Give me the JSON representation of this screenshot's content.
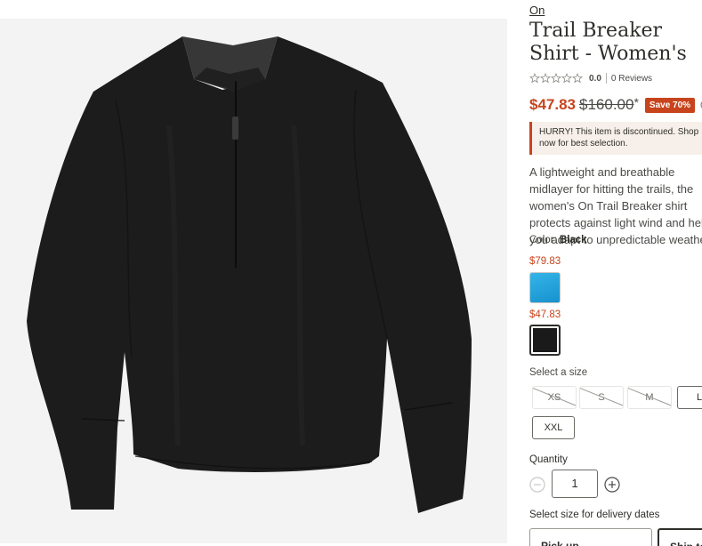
{
  "product": {
    "brand": "On",
    "title": "Trail Breaker Shirt - Women's",
    "rating": "0.0",
    "reviews": "0 Reviews",
    "sale_price": "$47.83",
    "original_price": "$160.00",
    "asterisk": "*",
    "save_badge": "Save 70%",
    "alert": "HURRY! This item is discontinued. Shop now for best selection.",
    "description": "A lightweight and breathable midlayer for hitting the trails, the women's On Trail Breaker shirt protects against light wind and helps you adapt to unpredictable weather."
  },
  "color": {
    "label": "Color:",
    "selected": "Black",
    "swatches": [
      {
        "price": "$79.83",
        "name": "Blue",
        "color": "#2aa6df"
      },
      {
        "price": "$47.83",
        "name": "Black",
        "color": "#1a1a1a"
      }
    ]
  },
  "sizes": {
    "label": "Select a size",
    "options": [
      {
        "label": "XS",
        "available": false
      },
      {
        "label": "S",
        "available": false
      },
      {
        "label": "M",
        "available": false
      },
      {
        "label": "L",
        "available": true
      },
      {
        "label": "XXL",
        "available": true
      }
    ]
  },
  "quantity": {
    "label": "Quantity",
    "value": "1"
  },
  "delivery": {
    "label": "Select size for delivery dates",
    "options": [
      "Pick up",
      "Ship to address"
    ]
  },
  "colors": {
    "accent": "#c7441d",
    "text": "#2e2e2b",
    "image_bg": "#f3f3f3"
  }
}
